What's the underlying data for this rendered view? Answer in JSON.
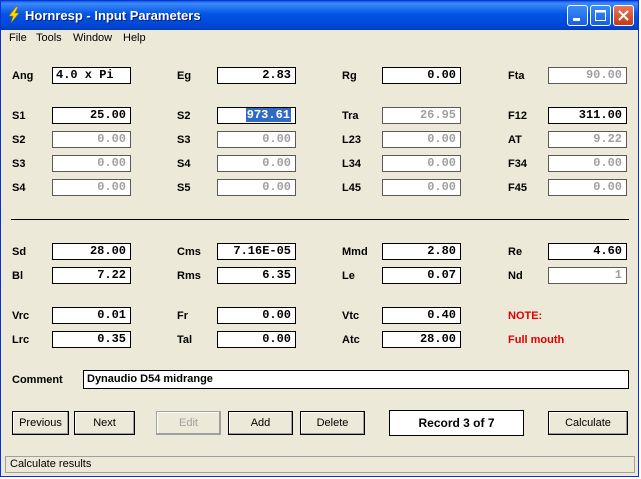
{
  "window": {
    "title": "Hornresp - Input Parameters"
  },
  "menu": [
    "File",
    "Tools",
    "Window",
    "Help"
  ],
  "fields": {
    "ang": {
      "label": "Ang",
      "value": "4.0 x Pi"
    },
    "eg": {
      "label": "Eg",
      "value": "2.83"
    },
    "rg": {
      "label": "Rg",
      "value": "0.00"
    },
    "fta": {
      "label": "Fta",
      "value": "90.00"
    },
    "s1": {
      "label": "S1",
      "value": "25.00"
    },
    "s2b": {
      "label": "S2",
      "value": "973.61"
    },
    "tra": {
      "label": "Tra",
      "value": "26.95"
    },
    "f12": {
      "label": "F12",
      "value": "311.00"
    },
    "s2a": {
      "label": "S2",
      "value": "0.00"
    },
    "s3b": {
      "label": "S3",
      "value": "0.00"
    },
    "l23": {
      "label": "L23",
      "value": "0.00"
    },
    "at": {
      "label": "AT",
      "value": "9.22"
    },
    "s3a": {
      "label": "S3",
      "value": "0.00"
    },
    "s4b": {
      "label": "S4",
      "value": "0.00"
    },
    "l34": {
      "label": "L34",
      "value": "0.00"
    },
    "f34": {
      "label": "F34",
      "value": "0.00"
    },
    "s4a": {
      "label": "S4",
      "value": "0.00"
    },
    "s5": {
      "label": "S5",
      "value": "0.00"
    },
    "l45": {
      "label": "L45",
      "value": "0.00"
    },
    "f45": {
      "label": "F45",
      "value": "0.00"
    },
    "sd": {
      "label": "Sd",
      "value": "28.00"
    },
    "cms": {
      "label": "Cms",
      "value": "7.16E-05"
    },
    "mmd": {
      "label": "Mmd",
      "value": "2.80"
    },
    "re": {
      "label": "Re",
      "value": "4.60"
    },
    "bl": {
      "label": "Bl",
      "value": "7.22"
    },
    "rms": {
      "label": "Rms",
      "value": "6.35"
    },
    "le": {
      "label": "Le",
      "value": "0.07"
    },
    "nd": {
      "label": "Nd",
      "value": "1"
    },
    "vrc": {
      "label": "Vrc",
      "value": "0.01"
    },
    "fr": {
      "label": "Fr",
      "value": "0.00"
    },
    "vtc": {
      "label": "Vtc",
      "value": "0.40"
    },
    "lrc": {
      "label": "Lrc",
      "value": "0.35"
    },
    "tal": {
      "label": "Tal",
      "value": "0.00"
    },
    "atc": {
      "label": "Atc",
      "value": "28.00"
    }
  },
  "note": {
    "title": "NOTE:",
    "text": "Full mouth"
  },
  "comment": {
    "label": "Comment",
    "value": "Dynaudio D54 midrange"
  },
  "buttons": {
    "previous": "Previous",
    "next": "Next",
    "edit": "Edit",
    "add": "Add",
    "delete": "Delete",
    "calculate": "Calculate"
  },
  "record": "Record 3 of 7",
  "status": "Calculate results",
  "colors": {
    "title_bar": "#0055e5",
    "note": "#e00000",
    "selection": "#316ac5",
    "disabled_text": "#a0a0a0"
  }
}
